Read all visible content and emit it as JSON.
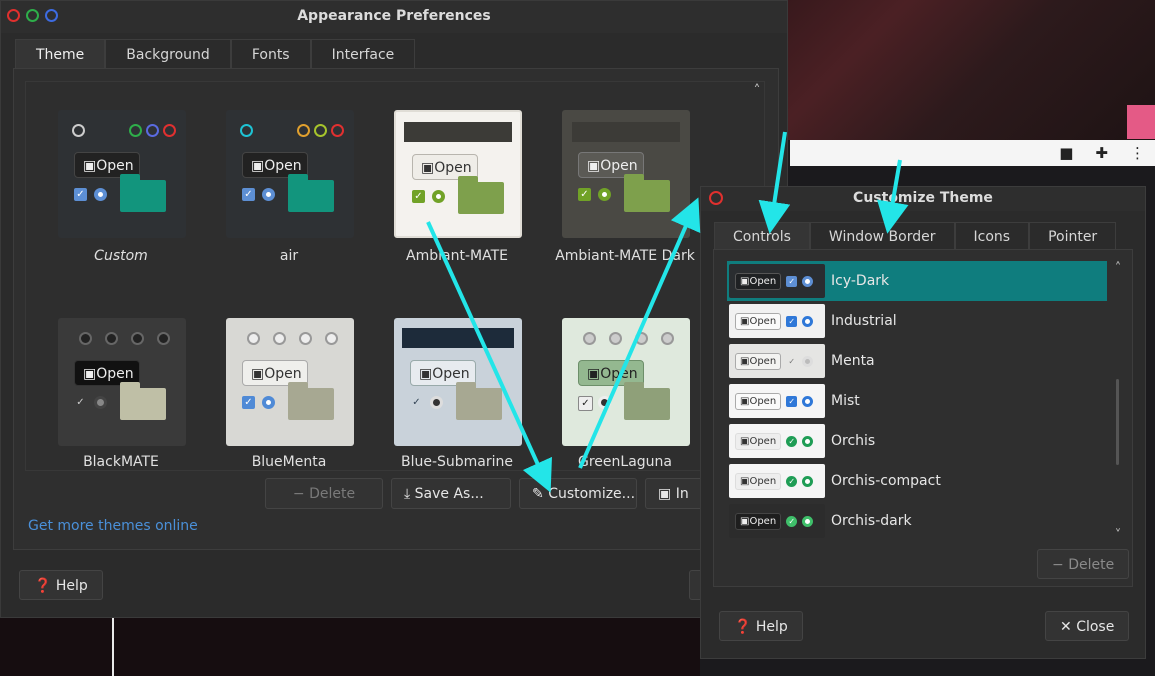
{
  "appearance": {
    "title": "Appearance Preferences",
    "tabs": [
      "Theme",
      "Background",
      "Fonts",
      "Interface"
    ],
    "themes": [
      {
        "name": "Custom",
        "italic": true
      },
      {
        "name": "air"
      },
      {
        "name": "Ambiant-MATE"
      },
      {
        "name": "Ambiant-MATE Dark"
      },
      {
        "name": "BlackMATE"
      },
      {
        "name": "BlueMenta"
      },
      {
        "name": "Blue-Submarine"
      },
      {
        "name": "GreenLaguna"
      }
    ],
    "preview_open_label": "Open",
    "actions": {
      "delete": "Delete",
      "save_as": "Save As...",
      "customize": "Customize...",
      "install": "In"
    },
    "more_themes_link": "Get more themes online",
    "help": "Help"
  },
  "customize": {
    "title": "Customize Theme",
    "tabs": [
      "Controls",
      "Window Border",
      "Icons",
      "Pointer"
    ],
    "preview_open_label": "Open",
    "themes": [
      {
        "name": "Icy-Dark",
        "selected": true
      },
      {
        "name": "Industrial"
      },
      {
        "name": "Menta"
      },
      {
        "name": "Mist"
      },
      {
        "name": "Orchis"
      },
      {
        "name": "Orchis-compact"
      },
      {
        "name": "Orchis-dark"
      }
    ],
    "delete": "Delete",
    "help": "Help",
    "close": "Close"
  },
  "colors": {
    "selection": "#0f7d7e",
    "annotation_arrow": "#23e5e8",
    "link": "#4a90d9"
  }
}
